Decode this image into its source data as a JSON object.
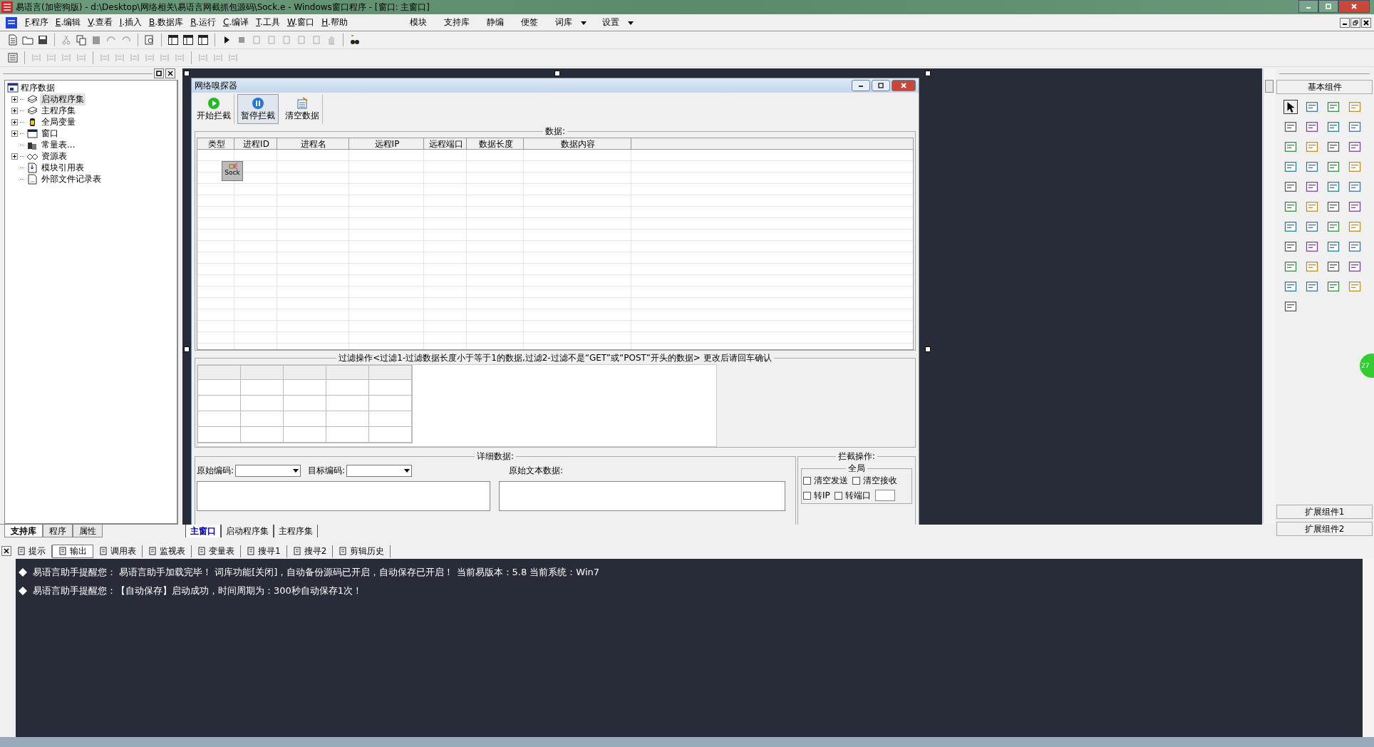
{
  "window": {
    "title": "易语言(加密狗版) - d:\\Desktop\\网络相关\\易语言网截抓包源码\\Sock.e - Windows窗口程序 - [窗口: 主窗口]"
  },
  "menu": [
    {
      "label": "F.程序"
    },
    {
      "label": "E.编辑"
    },
    {
      "label": "V.查看"
    },
    {
      "label": "I.插入"
    },
    {
      "label": "B.数据库"
    },
    {
      "label": "R.运行"
    },
    {
      "label": "C.编译"
    },
    {
      "label": "T.工具"
    },
    {
      "label": "W.窗口"
    },
    {
      "label": "H.帮助"
    }
  ],
  "menu_right": [
    {
      "label": "模块",
      "dropdown": false
    },
    {
      "label": "支持库",
      "dropdown": false
    },
    {
      "label": "静编",
      "dropdown": false
    },
    {
      "label": "便签",
      "dropdown": false
    },
    {
      "label": "词库",
      "dropdown": true
    },
    {
      "label": "设置",
      "dropdown": true
    }
  ],
  "tree": {
    "label": "程序数据",
    "children": [
      {
        "label": "启动程序集",
        "kind": "set",
        "expandable": true,
        "selected": true
      },
      {
        "label": "主程序集",
        "kind": "set",
        "expandable": true,
        "selected": false
      },
      {
        "label": "全局变量",
        "kind": "var",
        "expandable": true,
        "selected": false
      },
      {
        "label": "窗口",
        "kind": "window",
        "expandable": true,
        "selected": false
      },
      {
        "label": "常量表...",
        "kind": "const",
        "expandable": false,
        "selected": false
      },
      {
        "label": "资源表",
        "kind": "res",
        "expandable": true,
        "selected": false
      },
      {
        "label": "模块引用表",
        "kind": "module",
        "expandable": false,
        "selected": false
      },
      {
        "label": "外部文件记录表",
        "kind": "file",
        "expandable": false,
        "selected": false
      }
    ]
  },
  "left_tabs": [
    {
      "label": "支持库",
      "selected": true
    },
    {
      "label": "程序",
      "selected": false
    },
    {
      "label": "属性",
      "selected": false
    }
  ],
  "designer": {
    "title": "网络嗅探器",
    "buttons": [
      {
        "label": "开始拦截",
        "kind": "start",
        "pressed": false
      },
      {
        "label": "暂停拦截",
        "kind": "pause",
        "pressed": true
      },
      {
        "label": "清空数据",
        "kind": "clear",
        "pressed": false
      }
    ],
    "data_group": "数据:",
    "columns": [
      "类型",
      "进程ID",
      "进程名",
      "远程IP",
      "远程端口",
      "数据长度",
      "数据内容"
    ],
    "sock_component": "Sock",
    "filter_group": "过滤操作<过滤1-过滤数据长度小于等于1的数据,过滤2-过滤不是“GET”或“POST”开头的数据> 更改后请回车确认",
    "detail_group": "详细数据:",
    "source_encoding": "原始编码:",
    "target_encoding": "目标编码:",
    "raw_text": "原始文本数据:",
    "intercept_group": "拦截操作:",
    "global_group": "全局",
    "checkboxes": [
      {
        "label": "清空发送",
        "checked": false
      },
      {
        "label": "清空接收",
        "checked": false
      },
      {
        "label": "转IP",
        "checked": false
      },
      {
        "label": "转端口",
        "checked": false
      }
    ]
  },
  "editor_tabs": [
    {
      "label": "主窗口",
      "selected": true
    },
    {
      "label": "启动程序集",
      "selected": false
    },
    {
      "label": "主程序集",
      "selected": false
    }
  ],
  "toolbox": {
    "title": "基本组件",
    "sections": [
      "扩展组件1",
      "扩展组件2"
    ]
  },
  "floating_badge": "27",
  "output_tabs": [
    {
      "label": "提示",
      "selected": false
    },
    {
      "label": "输出",
      "selected": true
    },
    {
      "label": "调用表",
      "selected": false
    },
    {
      "label": "监视表",
      "selected": false
    },
    {
      "label": "变量表",
      "selected": false
    },
    {
      "label": "搜寻1",
      "selected": false
    },
    {
      "label": "搜寻2",
      "selected": false
    },
    {
      "label": "剪辑历史",
      "selected": false
    }
  ],
  "output_lines": [
    "易语言助手提醒您：  易语言助手加载完毕！  词库功能[关闭]，自动备份源码已开启，自动保存已开启！  当前易版本：5.8  当前系统：Win7",
    "易语言助手提醒您：【自动保存】启动成功，时间周期为：300秒自动保存1次！"
  ]
}
